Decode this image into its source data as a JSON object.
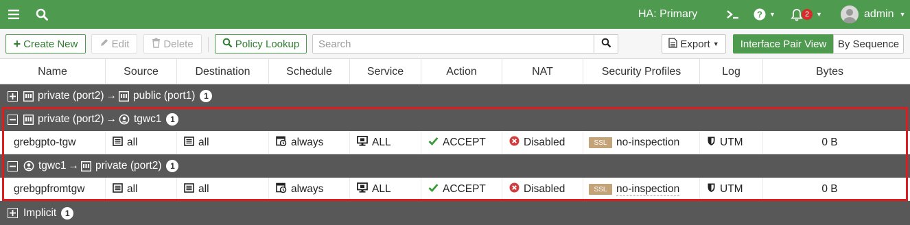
{
  "topbar": {
    "ha_status": "HA: Primary",
    "notification_count": "2",
    "user": "admin",
    "bg_color": "#4e9a4f"
  },
  "toolbar": {
    "create_new": "Create New",
    "edit": "Edit",
    "delete": "Delete",
    "policy_lookup": "Policy Lookup",
    "search_placeholder": "Search",
    "export": "Export",
    "view_interface_pair": "Interface Pair View",
    "view_by_sequence": "By Sequence"
  },
  "columns": [
    "Name",
    "Source",
    "Destination",
    "Schedule",
    "Service",
    "Action",
    "NAT",
    "Security Profiles",
    "Log",
    "Bytes"
  ],
  "groups": [
    {
      "from": "private (port2)",
      "arrow": "→",
      "to": "public (port1)",
      "count": "1",
      "expanded": false
    },
    {
      "from": "private (port2)",
      "arrow": "→",
      "to": "tgwc1",
      "count": "1",
      "expanded": true
    },
    {
      "from": "tgwc1",
      "arrow": "→",
      "to": "private (port2)",
      "count": "1",
      "expanded": true
    },
    {
      "label": "Implicit",
      "count": "1",
      "expanded": false
    }
  ],
  "policies": [
    {
      "name": "grebgpto-tgw",
      "source": "all",
      "destination": "all",
      "schedule": "always",
      "service": "ALL",
      "action": "ACCEPT",
      "nat": "Disabled",
      "ssl_tag": "SSL",
      "profile": "no-inspection",
      "log": "UTM",
      "bytes": "0 B"
    },
    {
      "name": "grebgpfromtgw",
      "source": "all",
      "destination": "all",
      "schedule": "always",
      "service": "ALL",
      "action": "ACCEPT",
      "nat": "Disabled",
      "ssl_tag": "SSL",
      "profile": "no-inspection",
      "log": "UTM",
      "bytes": "0 B"
    }
  ],
  "colors": {
    "accept": "#3a9a3a",
    "disabled": "#d23c3c",
    "highlight": "#e01b1b",
    "group_bg": "#585858"
  }
}
